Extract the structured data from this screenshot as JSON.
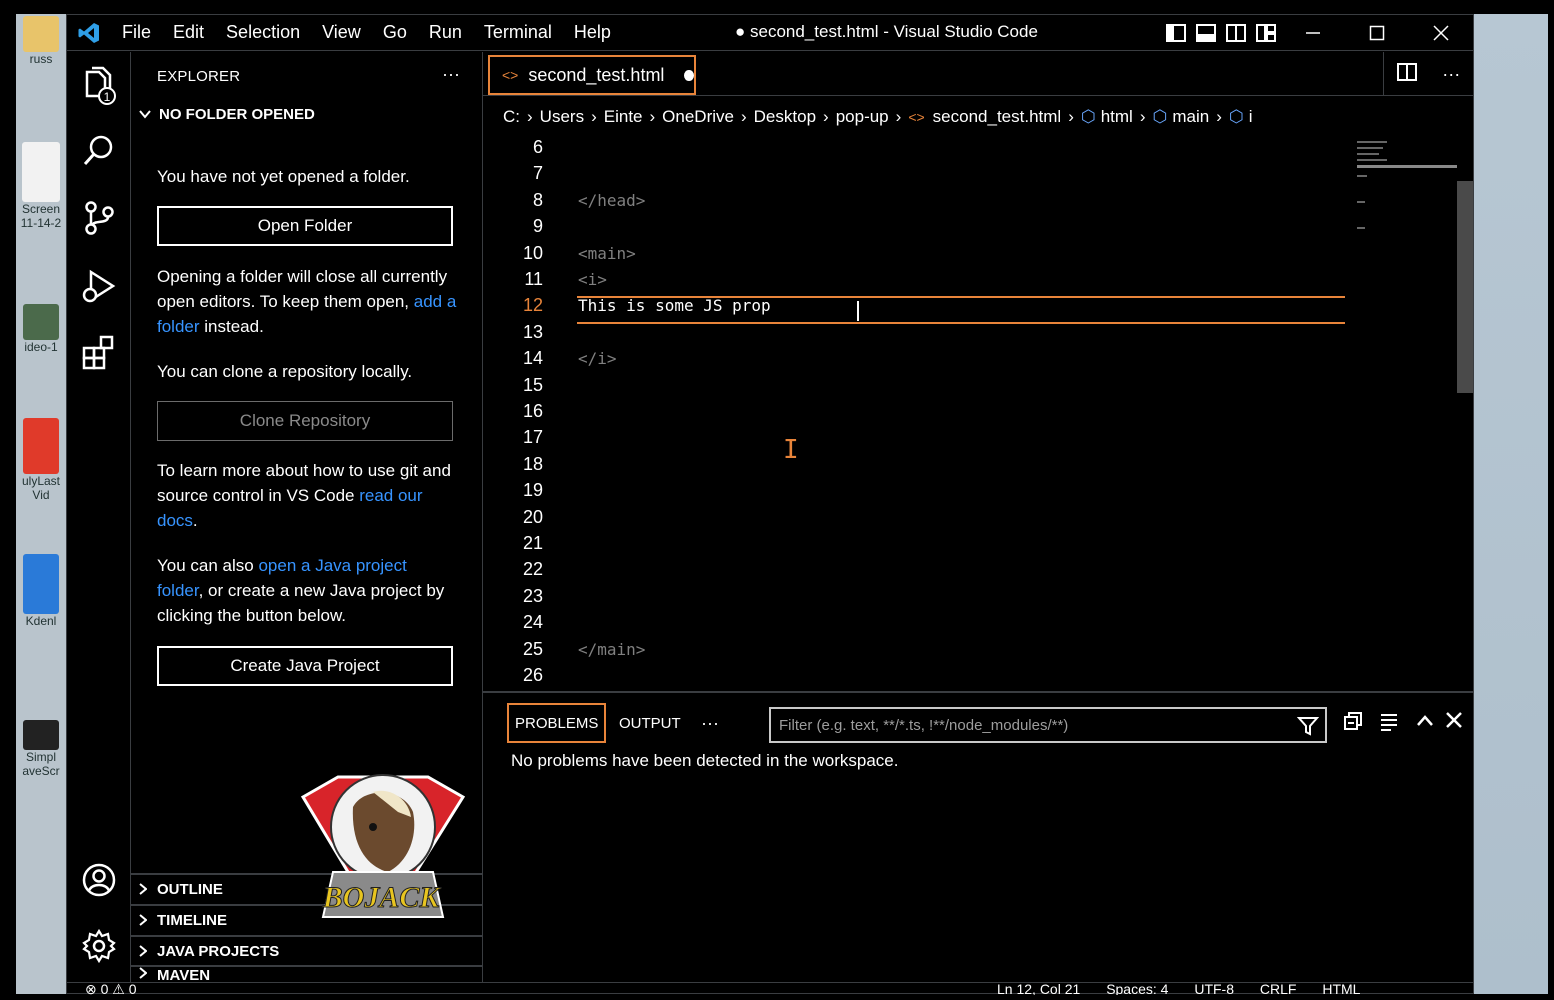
{
  "window": {
    "title": "● second_test.html - Visual Studio Code"
  },
  "menu": [
    "File",
    "Edit",
    "Selection",
    "View",
    "Go",
    "Run",
    "Terminal",
    "Help"
  ],
  "desktop": {
    "icons": [
      {
        "label": "russ",
        "color": "#e8c46a"
      },
      {
        "label": "Screen",
        "sub": "11-14-2",
        "color": "#f2f2f2"
      },
      {
        "label": "ideo-1",
        "color": "#4b6a4b"
      },
      {
        "label": "ulyLast",
        "sub": "Vid",
        "color": "#e03a2a"
      },
      {
        "label": "Kdenl",
        "color": "#2a7ad8"
      },
      {
        "label": "Simpl",
        "sub": "aveScr",
        "color": "#222"
      }
    ]
  },
  "sidebar": {
    "title": "EXPLORER",
    "more": "···",
    "section": "NO FOLDER OPENED",
    "no_folder_text": "You have not yet opened a folder.",
    "open_folder_btn": "Open Folder",
    "warn_text_a": "Opening a folder will close all currently open editors. To keep them open,",
    "warn_link": "add a folder",
    "warn_text_b": "instead.",
    "clone_text": "You can clone a repository locally.",
    "clone_btn": "Clone Repository",
    "git_text": "To learn more about how to use git and source control in VS Code",
    "git_link": "read our docs",
    "git_end": ".",
    "java_text_a": "You can also",
    "java_link": "open a Java project folder",
    "java_text_b": ", or create a new Java project by clicking the button below.",
    "java_btn": "Create Java Project",
    "mascot_text": "BOJACK",
    "sections": [
      "OUTLINE",
      "TIMELINE",
      "JAVA PROJECTS",
      "MAVEN"
    ]
  },
  "editor": {
    "tab_label": "second_test.html",
    "breadcrumb": [
      "C:",
      "Users",
      "Einte",
      "OneDrive",
      "Desktop",
      "pop-up",
      "second_test.html",
      "html",
      "main",
      "i"
    ],
    "lines": [
      {
        "n": "6",
        "text": ""
      },
      {
        "n": "7",
        "text": ""
      },
      {
        "n": "8",
        "text": "</head>"
      },
      {
        "n": "9",
        "text": ""
      },
      {
        "n": "10",
        "text": "<main>"
      },
      {
        "n": "11",
        "text": "<i>"
      },
      {
        "n": "12",
        "text": "This is some JS prop"
      },
      {
        "n": "13",
        "text": ""
      },
      {
        "n": "14",
        "text": "</i>"
      },
      {
        "n": "15",
        "text": ""
      },
      {
        "n": "16",
        "text": ""
      },
      {
        "n": "17",
        "text": ""
      },
      {
        "n": "18",
        "text": ""
      },
      {
        "n": "19",
        "text": ""
      },
      {
        "n": "20",
        "text": ""
      },
      {
        "n": "21",
        "text": ""
      },
      {
        "n": "22",
        "text": ""
      },
      {
        "n": "23",
        "text": ""
      },
      {
        "n": "24",
        "text": ""
      },
      {
        "n": "25",
        "text": "</main>"
      },
      {
        "n": "26",
        "text": ""
      }
    ],
    "active_line": "12"
  },
  "panel": {
    "tabs": [
      "PROBLEMS",
      "OUTPUT"
    ],
    "more": "···",
    "filter_placeholder": "Filter (e.g. text, **/*.ts, !**/node_modules/**)",
    "message": "No problems have been detected in the workspace."
  },
  "statusbar": {
    "left": "⊗ 0 ⚠ 0",
    "right": [
      "Ln 12, Col 21",
      "Spaces: 4",
      "UTF-8",
      "CRLF",
      "HTML"
    ]
  },
  "colors": {
    "accent": "#e8843a",
    "link": "#3794ff",
    "bg": "#000000",
    "border": "#3a3d41"
  }
}
